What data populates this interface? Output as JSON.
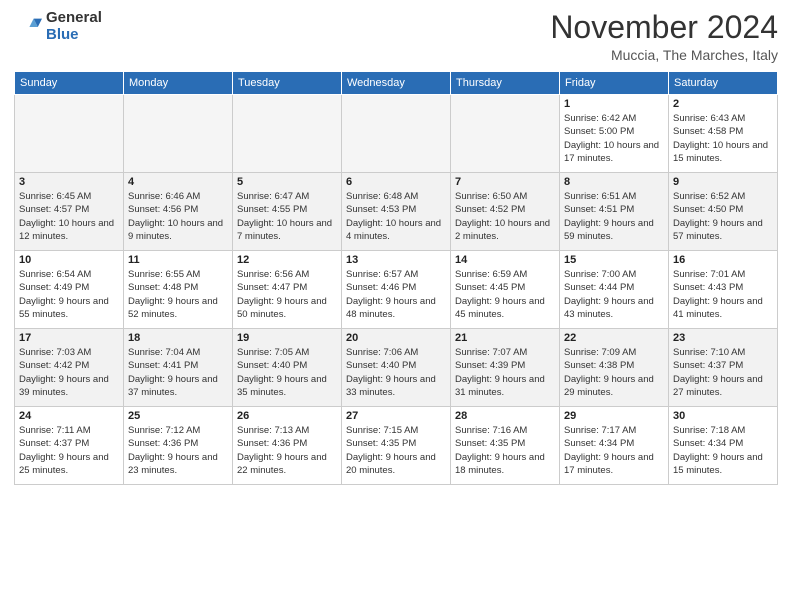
{
  "logo": {
    "general": "General",
    "blue": "Blue"
  },
  "title": "November 2024",
  "location": "Muccia, The Marches, Italy",
  "days_of_week": [
    "Sunday",
    "Monday",
    "Tuesday",
    "Wednesday",
    "Thursday",
    "Friday",
    "Saturday"
  ],
  "weeks": [
    [
      {
        "day": "",
        "empty": true
      },
      {
        "day": "",
        "empty": true
      },
      {
        "day": "",
        "empty": true
      },
      {
        "day": "",
        "empty": true
      },
      {
        "day": "",
        "empty": true
      },
      {
        "day": "1",
        "sunrise": "6:42 AM",
        "sunset": "5:00 PM",
        "daylight": "10 hours and 17 minutes."
      },
      {
        "day": "2",
        "sunrise": "6:43 AM",
        "sunset": "4:58 PM",
        "daylight": "10 hours and 15 minutes."
      }
    ],
    [
      {
        "day": "3",
        "sunrise": "6:45 AM",
        "sunset": "4:57 PM",
        "daylight": "10 hours and 12 minutes."
      },
      {
        "day": "4",
        "sunrise": "6:46 AM",
        "sunset": "4:56 PM",
        "daylight": "10 hours and 9 minutes."
      },
      {
        "day": "5",
        "sunrise": "6:47 AM",
        "sunset": "4:55 PM",
        "daylight": "10 hours and 7 minutes."
      },
      {
        "day": "6",
        "sunrise": "6:48 AM",
        "sunset": "4:53 PM",
        "daylight": "10 hours and 4 minutes."
      },
      {
        "day": "7",
        "sunrise": "6:50 AM",
        "sunset": "4:52 PM",
        "daylight": "10 hours and 2 minutes."
      },
      {
        "day": "8",
        "sunrise": "6:51 AM",
        "sunset": "4:51 PM",
        "daylight": "9 hours and 59 minutes."
      },
      {
        "day": "9",
        "sunrise": "6:52 AM",
        "sunset": "4:50 PM",
        "daylight": "9 hours and 57 minutes."
      }
    ],
    [
      {
        "day": "10",
        "sunrise": "6:54 AM",
        "sunset": "4:49 PM",
        "daylight": "9 hours and 55 minutes."
      },
      {
        "day": "11",
        "sunrise": "6:55 AM",
        "sunset": "4:48 PM",
        "daylight": "9 hours and 52 minutes."
      },
      {
        "day": "12",
        "sunrise": "6:56 AM",
        "sunset": "4:47 PM",
        "daylight": "9 hours and 50 minutes."
      },
      {
        "day": "13",
        "sunrise": "6:57 AM",
        "sunset": "4:46 PM",
        "daylight": "9 hours and 48 minutes."
      },
      {
        "day": "14",
        "sunrise": "6:59 AM",
        "sunset": "4:45 PM",
        "daylight": "9 hours and 45 minutes."
      },
      {
        "day": "15",
        "sunrise": "7:00 AM",
        "sunset": "4:44 PM",
        "daylight": "9 hours and 43 minutes."
      },
      {
        "day": "16",
        "sunrise": "7:01 AM",
        "sunset": "4:43 PM",
        "daylight": "9 hours and 41 minutes."
      }
    ],
    [
      {
        "day": "17",
        "sunrise": "7:03 AM",
        "sunset": "4:42 PM",
        "daylight": "9 hours and 39 minutes."
      },
      {
        "day": "18",
        "sunrise": "7:04 AM",
        "sunset": "4:41 PM",
        "daylight": "9 hours and 37 minutes."
      },
      {
        "day": "19",
        "sunrise": "7:05 AM",
        "sunset": "4:40 PM",
        "daylight": "9 hours and 35 minutes."
      },
      {
        "day": "20",
        "sunrise": "7:06 AM",
        "sunset": "4:40 PM",
        "daylight": "9 hours and 33 minutes."
      },
      {
        "day": "21",
        "sunrise": "7:07 AM",
        "sunset": "4:39 PM",
        "daylight": "9 hours and 31 minutes."
      },
      {
        "day": "22",
        "sunrise": "7:09 AM",
        "sunset": "4:38 PM",
        "daylight": "9 hours and 29 minutes."
      },
      {
        "day": "23",
        "sunrise": "7:10 AM",
        "sunset": "4:37 PM",
        "daylight": "9 hours and 27 minutes."
      }
    ],
    [
      {
        "day": "24",
        "sunrise": "7:11 AM",
        "sunset": "4:37 PM",
        "daylight": "9 hours and 25 minutes."
      },
      {
        "day": "25",
        "sunrise": "7:12 AM",
        "sunset": "4:36 PM",
        "daylight": "9 hours and 23 minutes."
      },
      {
        "day": "26",
        "sunrise": "7:13 AM",
        "sunset": "4:36 PM",
        "daylight": "9 hours and 22 minutes."
      },
      {
        "day": "27",
        "sunrise": "7:15 AM",
        "sunset": "4:35 PM",
        "daylight": "9 hours and 20 minutes."
      },
      {
        "day": "28",
        "sunrise": "7:16 AM",
        "sunset": "4:35 PM",
        "daylight": "9 hours and 18 minutes."
      },
      {
        "day": "29",
        "sunrise": "7:17 AM",
        "sunset": "4:34 PM",
        "daylight": "9 hours and 17 minutes."
      },
      {
        "day": "30",
        "sunrise": "7:18 AM",
        "sunset": "4:34 PM",
        "daylight": "9 hours and 15 minutes."
      }
    ]
  ],
  "labels": {
    "sunrise": "Sunrise:",
    "sunset": "Sunset:",
    "daylight": "Daylight:"
  }
}
